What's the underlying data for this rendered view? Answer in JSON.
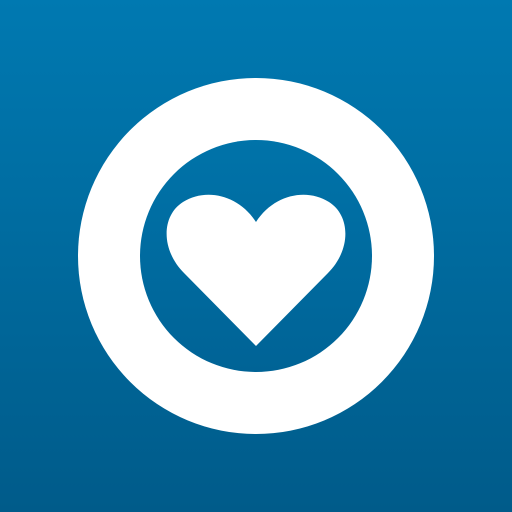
{
  "app_icon": {
    "symbol": "heart-icon",
    "colors": {
      "background_top": "#0079b1",
      "background_bottom": "#005b8a",
      "ring": "#ffffff",
      "heart": "#ffffff"
    }
  }
}
